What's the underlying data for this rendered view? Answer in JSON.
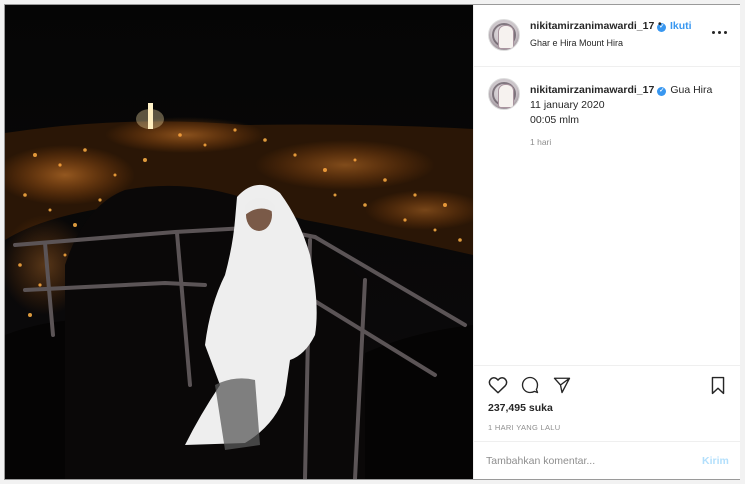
{
  "post": {
    "username": "nikitamirzanimawardi_17",
    "follow_label": "Ikuti",
    "location": "Ghar e Hira Mount Hira",
    "caption_text": "Gua Hira",
    "caption_lines": [
      "11 january 2020",
      "00:05 mlm"
    ],
    "caption_time": "1 hari",
    "likes": "237,495 suka",
    "posted_ago": "1 HARI YANG LALU",
    "comment_placeholder": "Tambahkan komentar...",
    "send_label": "Kirim"
  },
  "icons": {
    "verified": "verified-badge-icon",
    "like": "heart-icon",
    "comment": "comment-icon",
    "share": "share-icon",
    "save": "bookmark-icon",
    "more": "more-options-icon"
  },
  "colors": {
    "accent": "#3897f0",
    "text": "#262626",
    "muted": "#8e8e8e",
    "send_disabled": "#b2dffc"
  }
}
